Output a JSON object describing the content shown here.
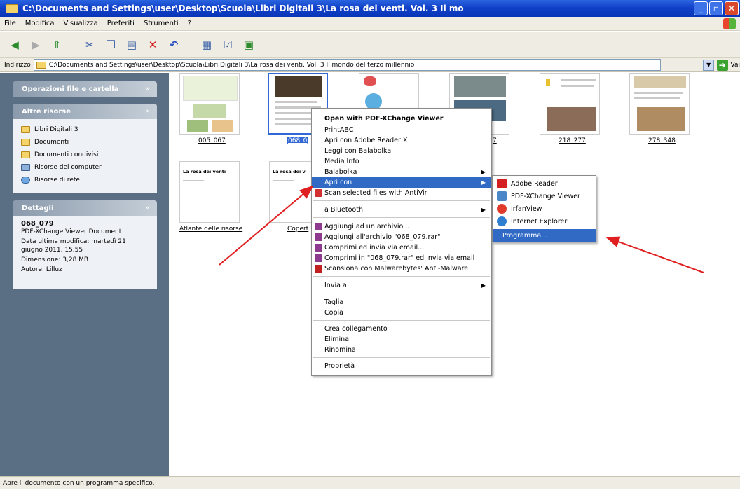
{
  "window": {
    "title": "C:\\Documents and Settings\\user\\Desktop\\Scuola\\Libri Digitali 3\\La rosa dei venti. Vol. 3  Il mo"
  },
  "menu": [
    "File",
    "Modifica",
    "Visualizza",
    "Preferiti",
    "Strumenti",
    "?"
  ],
  "address": {
    "label": "Indirizzo",
    "value": "C:\\Documents and Settings\\user\\Desktop\\Scuola\\Libri Digitali 3\\La rosa dei venti. Vol. 3  Il mondo del terzo millennio",
    "go_label": "Vai"
  },
  "tasks_panel": {
    "operations_title": "Operazioni file e cartella",
    "other_title": "Altre risorse",
    "other_items": [
      "Libri Digitali 3",
      "Documenti",
      "Documenti condivisi",
      "Risorse del computer",
      "Risorse di rete"
    ],
    "details_title": "Dettagli",
    "details": {
      "name": "068_079",
      "type": "PDF-XChange Viewer Document",
      "modified": "Data ultima modifica: martedì 21 giugno 2011, 15.55",
      "size": "Dimensione: 3,28 MB",
      "author": "Autore: Lilluz"
    }
  },
  "files": [
    {
      "label": "005_067",
      "selected": false
    },
    {
      "label": "068_0",
      "selected": true
    },
    {
      "label": "",
      "selected": false
    },
    {
      "label": "7",
      "selected": false
    },
    {
      "label": "218_277",
      "selected": false
    },
    {
      "label": "278_348",
      "selected": false
    },
    {
      "label": "Atlante delle risorse",
      "selected": false
    },
    {
      "label": "Copert",
      "selected": false
    }
  ],
  "thumb_text": {
    "rosa": "La rosa dei venti",
    "rosa_short": "La rosa dei v"
  },
  "context_menu": {
    "items": [
      "Open with PDF-XChange Viewer",
      "PrintABC",
      "Apri con Adobe Reader X",
      "Leggi con Balabolka",
      "Media Info",
      "Balabolka",
      "Apri con",
      "Scan selected files with AntiVir",
      "a Bluetooth",
      "Aggiungi ad un archivio...",
      "Aggiungi all'archivio \"068_079.rar\"",
      "Comprimi ed invia via email...",
      "Comprimi in \"068_079.rar\" ed invia via email",
      "Scansiona con Malwarebytes' Anti-Malware",
      "Invia a",
      "Taglia",
      "Copia",
      "Crea collegamento",
      "Elimina",
      "Rinomina",
      "Proprietà"
    ]
  },
  "submenu": {
    "items": [
      "Adobe Reader",
      "PDF-XChange Viewer",
      "IrfanView",
      "Internet Explorer",
      "Programma..."
    ]
  },
  "status": "Apre il documento con un programma specifico.",
  "colors": {
    "highlight": "#316ac5",
    "sidebar": "#5a6f84",
    "annotation_arrow": "#e02020"
  }
}
